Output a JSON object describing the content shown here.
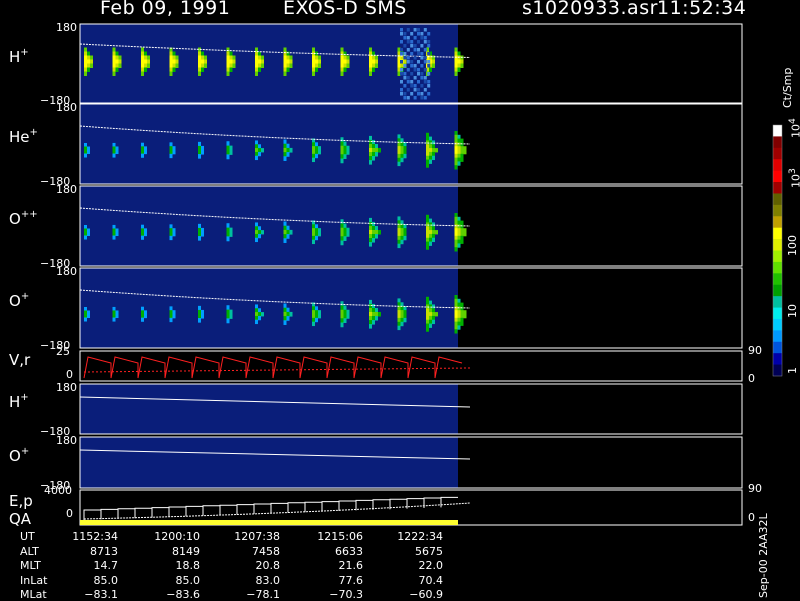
{
  "header": {
    "date": "Feb 09, 1991",
    "instrument": "EXOS-D SMS",
    "file": "s1020933.asr",
    "time": "11:52:34"
  },
  "colorbar": {
    "unit": "Ct/Smp",
    "ticks": [
      "1",
      "10",
      "100",
      "10",
      "10"
    ],
    "tick_exponents": [
      "",
      "",
      "",
      "3",
      "4"
    ],
    "colors": [
      "#000055",
      "#0000aa",
      "#0055dd",
      "#0099ff",
      "#00ccff",
      "#00eeee",
      "#00c0a0",
      "#00a000",
      "#20c000",
      "#60e000",
      "#a0f000",
      "#e0f000",
      "#ffff00",
      "#c0a000",
      "#808000",
      "#606000",
      "#a00000",
      "#ff0000",
      "#e00000",
      "#a00000",
      "#800000",
      "#ffffff"
    ]
  },
  "panels": [
    {
      "label": "H",
      "charge": "+",
      "top_tick": "180",
      "bottom_tick": "−180"
    },
    {
      "label": "He",
      "charge": "+",
      "top_tick": "180",
      "bottom_tick": "−180"
    },
    {
      "label": "O",
      "charge": "++",
      "top_tick": "180",
      "bottom_tick": "−180"
    },
    {
      "label": "O",
      "charge": "+",
      "top_tick": "180",
      "bottom_tick": "−180"
    }
  ],
  "vr_panel": {
    "label": "V,r",
    "left_top": "25",
    "left_bottom": "0",
    "right_top": "90",
    "right_bottom": "0"
  },
  "lower_panels": [
    {
      "label": "H",
      "charge": "+",
      "top_tick": "180",
      "bottom_tick": "−180"
    },
    {
      "label": "O",
      "charge": "+",
      "top_tick": "180",
      "bottom_tick": "−180"
    }
  ],
  "ep_panel": {
    "label1": "E,p",
    "label2": "QA",
    "left_top": "4000",
    "left_bottom": "0",
    "right_top": "90",
    "right_bottom": "0"
  },
  "ephemeris": {
    "rows": [
      {
        "name": "UT",
        "values": [
          "1152:34",
          "1200:10",
          "1207:38",
          "1215:06",
          "1222:34"
        ]
      },
      {
        "name": "ALT",
        "values": [
          "8713",
          "8149",
          "7458",
          "6633",
          "5675"
        ]
      },
      {
        "name": "MLT",
        "values": [
          "14.7",
          "18.8",
          "20.8",
          "21.6",
          "22.0"
        ]
      },
      {
        "name": "InLat",
        "values": [
          "85.0",
          "85.0",
          "83.0",
          "77.6",
          "70.4"
        ]
      },
      {
        "name": "MLat",
        "values": [
          "−83.1",
          "−83.6",
          "−78.1",
          "−70.3",
          "−60.9"
        ]
      }
    ]
  },
  "footer_tag": "Sep-00  2AA32L",
  "chart_data": {
    "type": "heatmap",
    "title": "Feb 09, 1991   EXOS-D SMS",
    "x": [
      "1152:34",
      "1200:10",
      "1207:38",
      "1215:06",
      "1222:34"
    ],
    "ylim": [
      -180,
      180
    ],
    "series": [
      {
        "name": "H+",
        "bursts": 14
      },
      {
        "name": "He+",
        "bursts": 14
      },
      {
        "name": "O++",
        "bursts": 14
      },
      {
        "name": "O+",
        "bursts": 14
      }
    ],
    "color_scale": {
      "min": 1,
      "max": 10000,
      "log": true
    }
  }
}
